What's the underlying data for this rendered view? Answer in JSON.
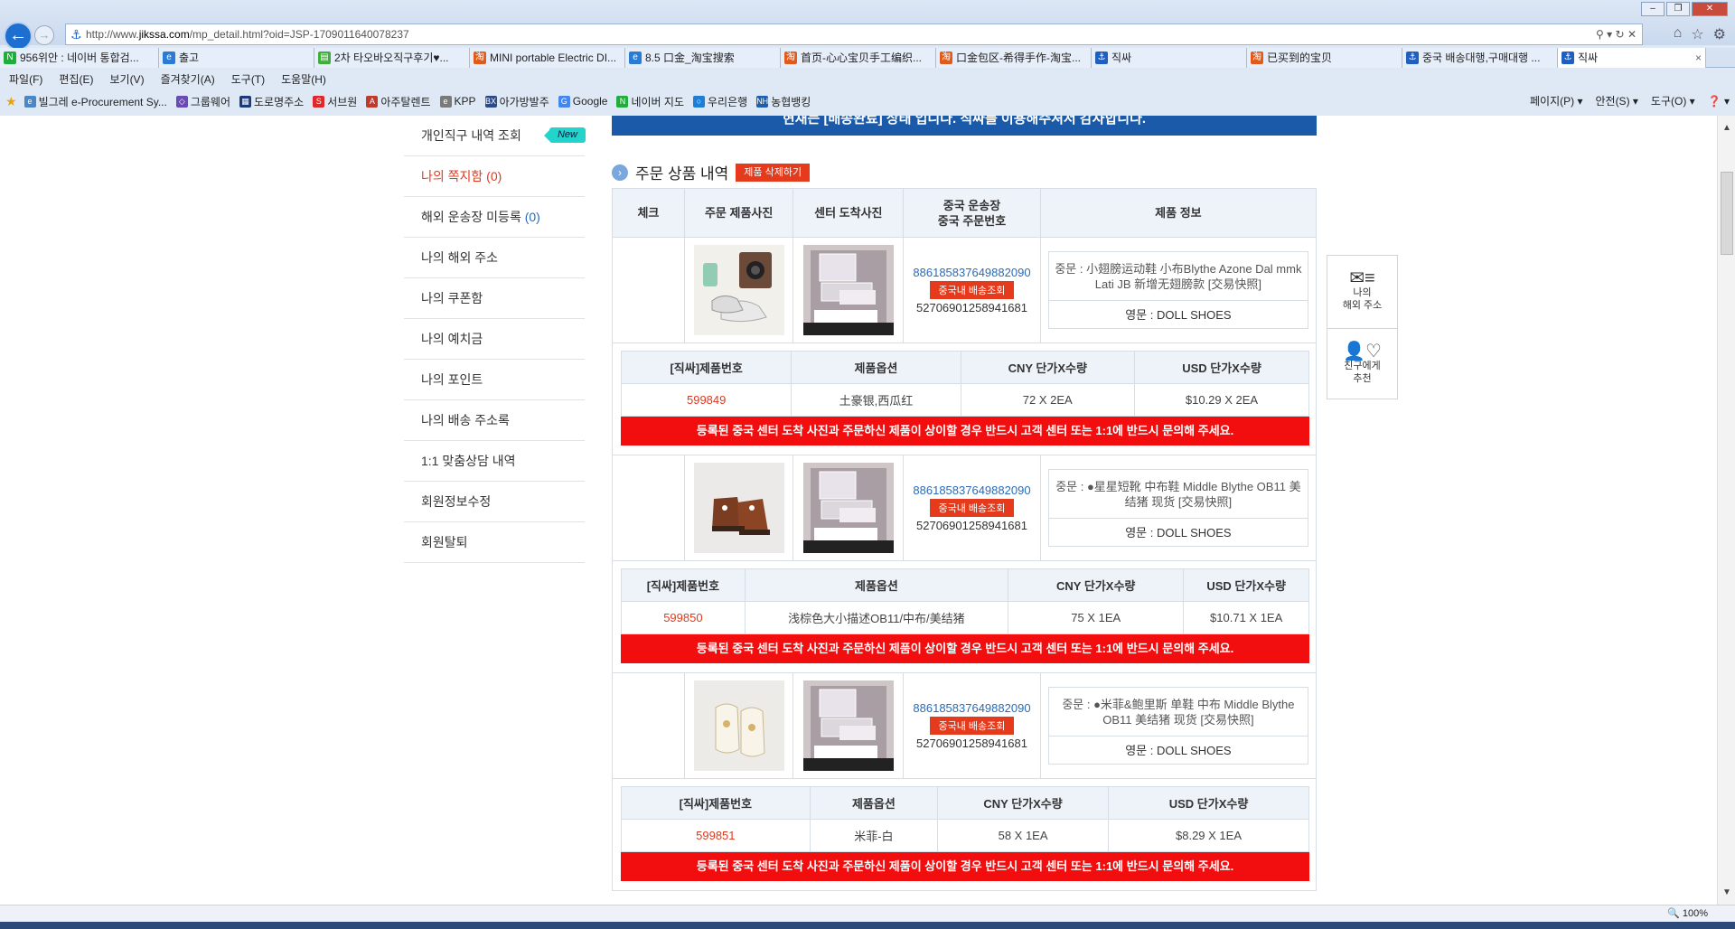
{
  "browser": {
    "url_prefix": "http://www.",
    "url_host": "jikssa.com",
    "url_path": "/mp_detail.html?oid=JSP-1709011640078237",
    "tabs": [
      {
        "label": "956위안 : 네이버 통합검...",
        "color": "#1fae3b",
        "glyph": "N"
      },
      {
        "label": "출고",
        "color": "#2a7bd6",
        "glyph": "e"
      },
      {
        "label": "2차 타오바오직구후기♥...",
        "color": "#3fae3b",
        "glyph": "▤"
      },
      {
        "label": "MINI portable Electric DI...",
        "color": "#e05b1b",
        "glyph": "淘"
      },
      {
        "label": "8.5 口金_淘宝搜索",
        "color": "#2a7bd6",
        "glyph": "e"
      },
      {
        "label": "首页-心心宝贝手工编织...",
        "color": "#e05b1b",
        "glyph": "淘"
      },
      {
        "label": "口金包区-希得手作-淘宝...",
        "color": "#e05b1b",
        "glyph": "淘"
      },
      {
        "label": "직싸",
        "color": "#1f5fbf",
        "glyph": "⚓"
      },
      {
        "label": "已买到的宝贝",
        "color": "#e05b1b",
        "glyph": "淘"
      },
      {
        "label": "중국 배송대행,구매대행 ...",
        "color": "#1f5fbf",
        "glyph": "⚓"
      },
      {
        "label": "직싸",
        "color": "#1f5fbf",
        "glyph": "⚓"
      }
    ],
    "close_tab": "×",
    "menu": [
      "파일(F)",
      "편집(E)",
      "보기(V)",
      "즐겨찾기(A)",
      "도구(T)",
      "도움말(H)"
    ],
    "favorites": [
      {
        "label": "빌그레 e-Procurement Sy...",
        "color": "#4a86c8",
        "glyph": "e"
      },
      {
        "label": "그룹웨어",
        "color": "#6a4ab8",
        "glyph": "◇"
      },
      {
        "label": "도로명주소",
        "color": "#1b3a7a",
        "glyph": "▦"
      },
      {
        "label": "서브원",
        "color": "#e0282a",
        "glyph": "S"
      },
      {
        "label": "아주탈렌트",
        "color": "#c0392b",
        "glyph": "A"
      },
      {
        "label": "KPP",
        "color": "#7a7a7a",
        "glyph": "e"
      },
      {
        "label": "아가방발주",
        "color": "#2a4a8a",
        "glyph": "BX"
      },
      {
        "label": "Google",
        "color": "#4285f4",
        "glyph": "G"
      },
      {
        "label": "네이버 지도",
        "color": "#1fae3b",
        "glyph": "N"
      },
      {
        "label": "우리은행",
        "color": "#1c7ed6",
        "glyph": "○"
      },
      {
        "label": "농협뱅킹",
        "color": "#1c5fb0",
        "glyph": "NH"
      }
    ],
    "commands": [
      "페이지(P) ▾",
      "안전(S) ▾",
      "도구(O) ▾",
      "❓ ▾"
    ],
    "zoom": "🔍 100%"
  },
  "sidebar": {
    "items": [
      {
        "label": "개인직구 내역 조회",
        "count": "",
        "badge": "New",
        "red": false
      },
      {
        "label": "나의 쪽지함",
        "count": " (0)",
        "badge": "",
        "red": true
      },
      {
        "label": "해외 운송장 미등록",
        "count": " (0)",
        "badge": "",
        "red": false
      },
      {
        "label": "나의 해외 주소",
        "count": "",
        "badge": "",
        "red": false
      },
      {
        "label": "나의 쿠폰함",
        "count": "",
        "badge": "",
        "red": false
      },
      {
        "label": "나의 예치금",
        "count": "",
        "badge": "",
        "red": false
      },
      {
        "label": "나의 포인트",
        "count": "",
        "badge": "",
        "red": false
      },
      {
        "label": "나의 배송 주소록",
        "count": "",
        "badge": "",
        "red": false
      },
      {
        "label": "1:1 맞춤상담 내역",
        "count": "",
        "badge": "",
        "red": false
      },
      {
        "label": "회원정보수정",
        "count": "",
        "badge": "",
        "red": false
      },
      {
        "label": "회원탈퇴",
        "count": "",
        "badge": "",
        "red": false
      }
    ]
  },
  "banner_text": "현재는 [배송완료] 상태 입니다. 직싸를 이용해주셔서 감사합니다.",
  "section": {
    "title": "주문 상품 내역",
    "delete_button": "제품 삭제하기"
  },
  "table_header": {
    "check": "체크",
    "order_photo": "주문 제품사진",
    "center_photo": "센터 도착사진",
    "cn_ship_1": "중국 운송장",
    "cn_ship_2": "중국 주문번호",
    "info": "제품 정보"
  },
  "sub_header": {
    "code": "[직싸]제품번호",
    "option": "제품옵션",
    "cny": "CNY 단가X수량",
    "usd": "USD 단가X수량"
  },
  "ship_button": "중국내 배송조회",
  "warning": "등록된 중국 센터 도착 사진과 주문하신 제품이 상이할 경우 반드시 고객 센터 또는 1:1에 반드시 문의해 주세요.",
  "products": [
    {
      "tracking": "886185837649882090",
      "order_no": "5270690125894168​1",
      "zh": "중문 : 小翅膀运动鞋 小布Blythe Azone Dal mmk Lati JB 新增无翅膀款 [交易快照]",
      "en": "영문 : DOLL SHOES",
      "code": "599849",
      "option": "土豪银,西瓜红",
      "cny": "72 X 2EA",
      "usd": "$10.29 X 2EA"
    },
    {
      "tracking": "886185837649882090",
      "order_no": "5270690125894168​1",
      "zh": "중문 : ●星星短靴 中布鞋 Middle Blythe OB11 美结猪 现货 [交易快照]",
      "en": "영문 : DOLL SHOES",
      "code": "599850",
      "option": "浅棕色大小描述OB11/中布/美结猪",
      "cny": "75 X 1EA",
      "usd": "$10.71 X 1EA"
    },
    {
      "tracking": "886185837649882090",
      "order_no": "5270690125894168​1",
      "zh": "중문 : ●米菲&鲍里斯 单鞋 中布 Middle Blythe OB11 美结猪 现货 [交易快照]",
      "en": "영문 : DOLL SHOES",
      "code": "599851",
      "option": "米菲-白",
      "cny": "58 X 1EA",
      "usd": "$8.29 X 1EA"
    }
  ],
  "quick_menu": {
    "item1_l1": "나의",
    "item1_l2": "해외 주소",
    "item2_l1": "친구에게",
    "item2_l2": "추천"
  }
}
